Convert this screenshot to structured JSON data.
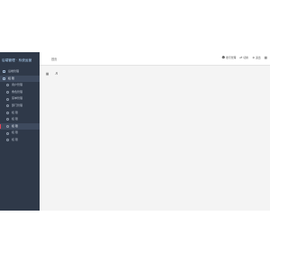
{
  "app": {
    "title": "后端管理 · 系统运营"
  },
  "sidebar": {
    "items": [
      {
        "label": "后端管理",
        "level": "top",
        "active": false,
        "badge": "",
        "accent": false
      },
      {
        "label": "权   限",
        "level": "top",
        "active": true,
        "badge": "",
        "accent": false
      },
      {
        "label": "用户管理",
        "level": "sub",
        "active": false,
        "badge": "",
        "accent": false
      },
      {
        "label": "角色管理",
        "level": "sub",
        "active": false,
        "badge": "",
        "accent": false
      },
      {
        "label": "菜单管理",
        "level": "sub",
        "active": false,
        "badge": "",
        "accent": false
      },
      {
        "label": "部门管理",
        "level": "sub",
        "active": false,
        "badge": "",
        "accent": false
      },
      {
        "label": "权   限",
        "level": "sub",
        "active": false,
        "badge": "",
        "accent": false
      },
      {
        "label": "权   限",
        "level": "sub",
        "active": false,
        "badge": "",
        "accent": false
      },
      {
        "label": "权   限",
        "level": "sub",
        "active": true,
        "badge": "",
        "accent": true
      },
      {
        "label": "权   限",
        "level": "sub",
        "active": false,
        "badge": "",
        "accent": false
      },
      {
        "label": "权   限",
        "level": "sub",
        "active": false,
        "badge": "",
        "accent": false
      }
    ]
  },
  "header": {
    "breadcrumb": "首页",
    "actions": [
      {
        "label": "账号管理",
        "icon": "user-icon"
      },
      {
        "label": "切换",
        "icon": "switch-icon"
      },
      {
        "label": "退出",
        "icon": "logout-icon"
      },
      {
        "label": "",
        "icon": "more-icon"
      }
    ]
  },
  "toolbar": {
    "buttons": [
      {
        "icon": "grid-icon"
      },
      {
        "icon": "volume-icon"
      }
    ]
  },
  "colors": {
    "sidebar_bg": "#2f3949",
    "sidebar_active": "#3e4a5e",
    "accent": "#e0465b",
    "brand": "#b7dcff",
    "content_bg": "#f4f4f4"
  }
}
